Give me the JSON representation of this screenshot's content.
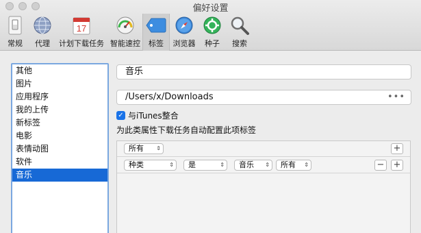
{
  "window": {
    "title": "偏好设置"
  },
  "toolbar": {
    "items": [
      {
        "label": "常规",
        "icon": "switch-icon"
      },
      {
        "label": "代理",
        "icon": "globe-icon"
      },
      {
        "label": "计划下载任务",
        "icon": "calendar-icon",
        "calendar_day": "17"
      },
      {
        "label": "智能速控",
        "icon": "speedometer-icon"
      },
      {
        "label": "标签",
        "icon": "tag-icon",
        "selected": true
      },
      {
        "label": "浏览器",
        "icon": "compass-icon"
      },
      {
        "label": "种子",
        "icon": "gear-icon"
      },
      {
        "label": "搜索",
        "icon": "magnifier-icon"
      }
    ]
  },
  "sidebar": {
    "items": [
      {
        "label": "其他"
      },
      {
        "label": "图片"
      },
      {
        "label": "应用程序"
      },
      {
        "label": "我的上传"
      },
      {
        "label": "新标签"
      },
      {
        "label": "电影"
      },
      {
        "label": "表情动图"
      },
      {
        "label": "软件"
      },
      {
        "label": "音乐",
        "selected": true
      }
    ]
  },
  "detail": {
    "tag_name": "音乐",
    "path": "/Users/x/Downloads",
    "path_button": "•••",
    "itunes_checkbox": {
      "label": "与iTunes整合",
      "checked": true
    },
    "description": "为此类属性下载任务自动配置此项标签",
    "rules": {
      "match_select": "所有",
      "add_symbol": "+",
      "remove_symbol": "−",
      "row": {
        "field": "种类",
        "operator": "是",
        "value": "音乐",
        "scope": "所有"
      }
    }
  },
  "colors": {
    "selection": "#1769d6",
    "checkbox": "#1a73e8",
    "list_focus": "#7aa7e0"
  }
}
